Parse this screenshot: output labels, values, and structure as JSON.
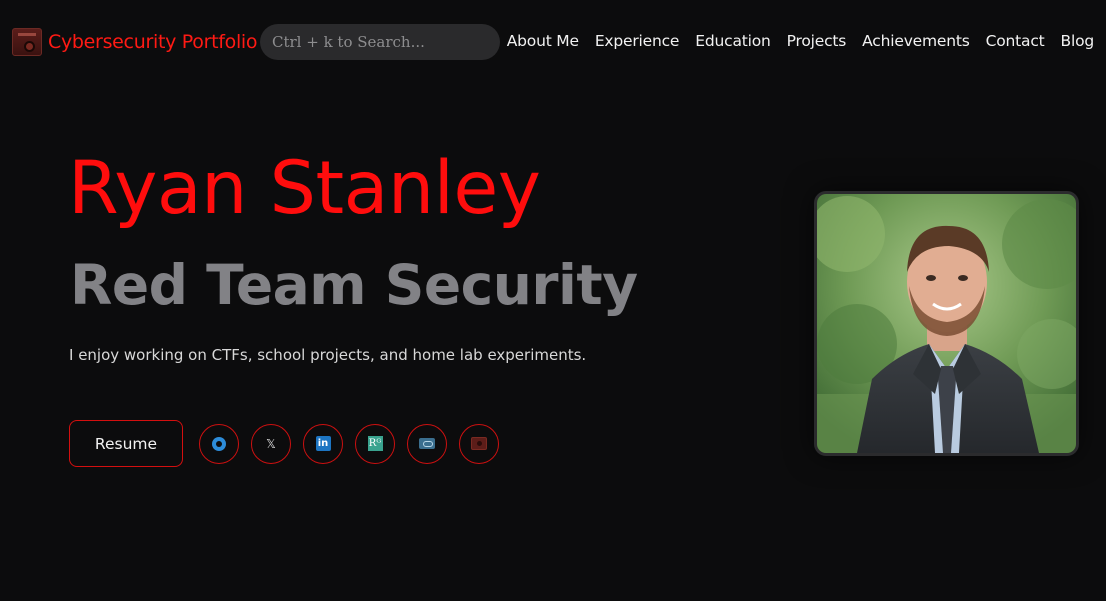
{
  "nav": {
    "brand": "Cybersecurity Portfolio",
    "search_placeholder": "Ctrl + k to Search...",
    "links": [
      "About Me",
      "Experience",
      "Education",
      "Projects",
      "Achievements",
      "Contact",
      "Blog"
    ]
  },
  "hero": {
    "name": "Ryan Stanley",
    "title": "Red Team Security",
    "description": "I enjoy working on CTFs, school projects, and home lab experiments.",
    "resume_label": "Resume"
  },
  "socials": [
    {
      "icon": "github-icon"
    },
    {
      "icon": "x-icon",
      "glyph": "𝕏"
    },
    {
      "icon": "linkedin-icon",
      "glyph": "in"
    },
    {
      "icon": "researchgate-icon",
      "glyph": "Rᴳ"
    },
    {
      "icon": "game-portal-icon"
    },
    {
      "icon": "portfolio-icon"
    }
  ],
  "colors": {
    "background": "#0c0c0d",
    "accent": "#ff0d0d",
    "title_gray": "#828286",
    "search_bg": "#2a2a2c"
  }
}
